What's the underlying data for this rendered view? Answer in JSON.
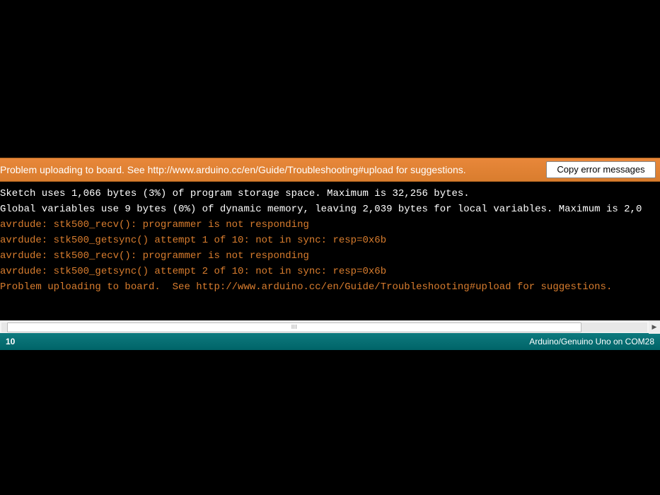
{
  "error_bar": {
    "message": "Problem uploading to board.  See http://www.arduino.cc/en/Guide/Troubleshooting#upload for suggestions.",
    "copy_button": "Copy error messages"
  },
  "console": {
    "lines": [
      {
        "text": "Sketch uses 1,066 bytes (3%) of program storage space. Maximum is 32,256 bytes.",
        "cls": "white"
      },
      {
        "text": "Global variables use 9 bytes (0%) of dynamic memory, leaving 2,039 bytes for local variables. Maximum is 2,0",
        "cls": "white"
      },
      {
        "text": "avrdude: stk500_recv(): programmer is not responding",
        "cls": "orange"
      },
      {
        "text": "avrdude: stk500_getsync() attempt 1 of 10: not in sync: resp=0x6b",
        "cls": "orange"
      },
      {
        "text": "avrdude: stk500_recv(): programmer is not responding",
        "cls": "orange"
      },
      {
        "text": "avrdude: stk500_getsync() attempt 2 of 10: not in sync: resp=0x6b",
        "cls": "orange"
      },
      {
        "text": "Problem uploading to board.  See http://www.arduino.cc/en/Guide/Troubleshooting#upload for suggestions.",
        "cls": "orange"
      }
    ]
  },
  "status_bar": {
    "left": "10",
    "right": "Arduino/Genuino Uno on COM28"
  },
  "colors": {
    "error_bg": "#d97d2e",
    "status_bg": "#006468",
    "error_text": "#d97d2e"
  }
}
